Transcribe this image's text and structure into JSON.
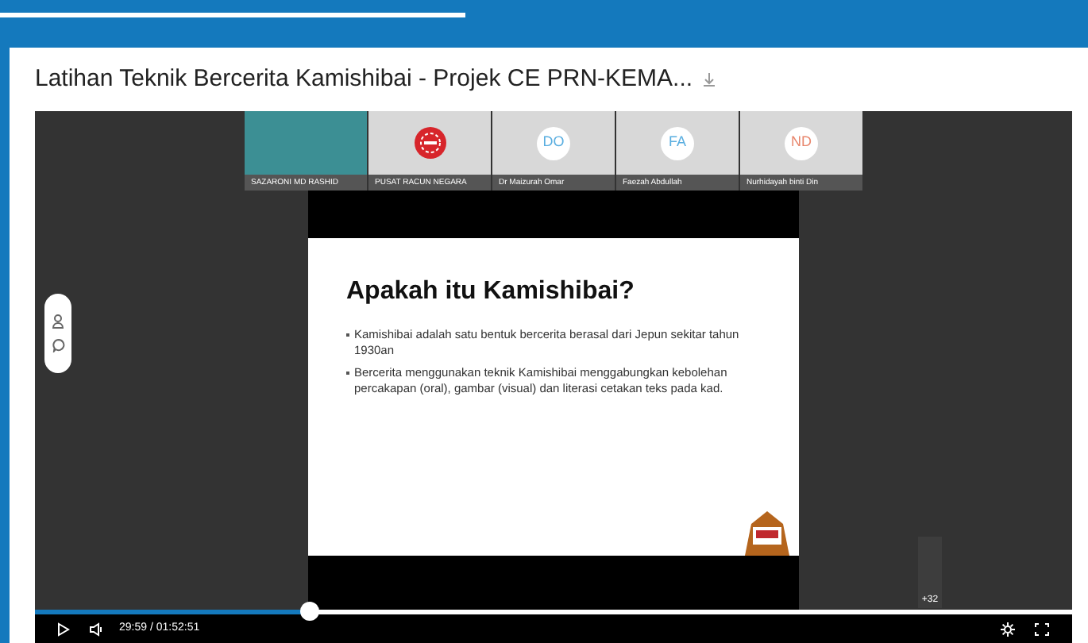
{
  "page": {
    "title": "Latihan Teknik Bercerita Kamishibai - Projek CE PRN-KEMA..."
  },
  "participants": [
    {
      "name": "SAZARONI MD RASHID",
      "kind": "video"
    },
    {
      "name": "PUSAT RACUN NEGARA",
      "kind": "logo"
    },
    {
      "name": "Dr Maizurah Omar",
      "kind": "initials",
      "initials": "DO",
      "color": "#5aaee0"
    },
    {
      "name": "Faezah Abdullah",
      "kind": "initials",
      "initials": "FA",
      "color": "#5aaee0"
    },
    {
      "name": "Nurhidayah binti Din",
      "kind": "initials",
      "initials": "ND",
      "color": "#e8866c"
    }
  ],
  "slide": {
    "heading": "Apakah itu Kamishibai?",
    "bullets": [
      "Kamishibai adalah satu bentuk bercerita berasal dari Jepun sekitar tahun 1930an",
      "Bercerita menggunakan teknik Kamishibai menggabungkan kebolehan percakapan (oral), gambar (visual) dan literasi cetakan teks pada kad."
    ]
  },
  "more_participants": "+32",
  "player": {
    "level": 0.265,
    "time": "29:59 / 01:52:51"
  }
}
